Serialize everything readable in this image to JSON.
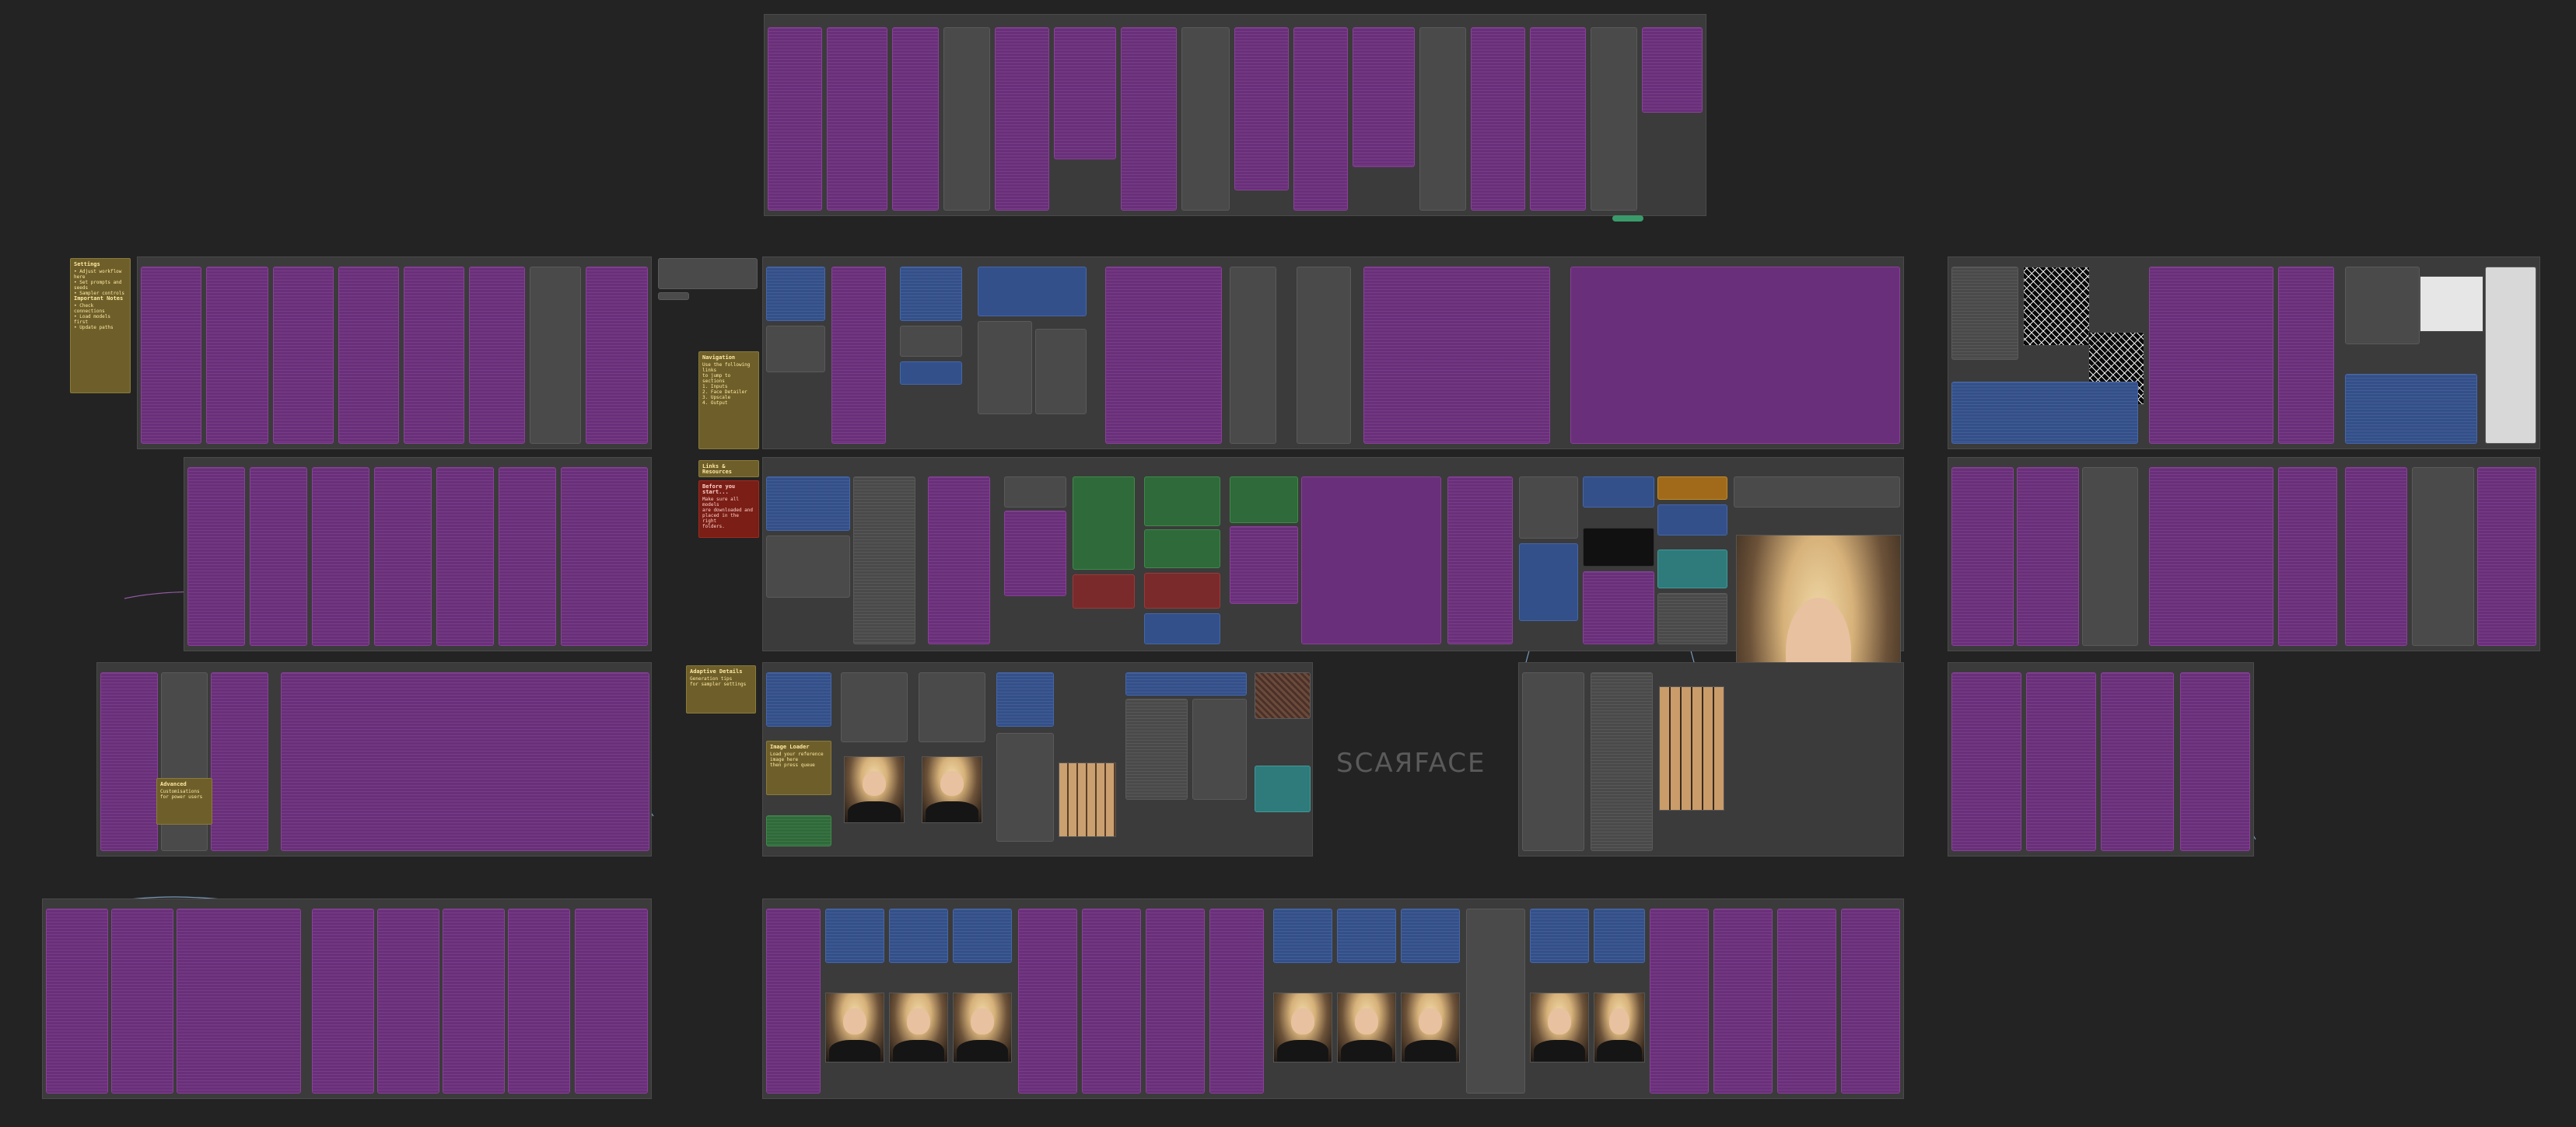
{
  "canvas": {
    "background": "#232323",
    "watermark": "SCAЯFACE",
    "colors": {
      "purple_node": "#6a2f7a",
      "blue_node": "#34508a",
      "green_node": "#2f6a3a",
      "red_node": "#7a2a2a",
      "teal_node": "#2f7a7a",
      "note_yellow": "#6e5f2a",
      "note_red": "#7a1e16",
      "wire_blue": "#8fb8e0",
      "wire_purple": "#c070d8"
    }
  },
  "notes": {
    "left_note": {
      "title": "Settings",
      "lines": [
        "• Adjust workflow here",
        "• Set prompts and seeds",
        "• Sampler controls",
        "Important Notes",
        "• Check connections",
        "• Load models first",
        "• Update paths"
      ]
    },
    "navigation": {
      "title": "Navigation",
      "lines": [
        "Use the following links",
        "to jump to sections",
        "1. Inputs",
        "2. Face Detailer",
        "3. Upscale",
        "4. Output"
      ]
    },
    "links": {
      "title": "Links & Resources"
    },
    "warning": {
      "title": "Before you start...",
      "lines": [
        "Make sure all models",
        "are downloaded and",
        "placed in the right",
        "folders."
      ]
    },
    "adaptive": {
      "title": "Adaptive Details",
      "lines": [
        "Generation tips",
        "for sampler settings"
      ]
    },
    "image_loader": {
      "title": "Image Loader",
      "lines": [
        "Load your reference",
        "image here",
        "then press queue"
      ]
    },
    "advanced": {
      "title": "Advanced",
      "lines": [
        "Customisations",
        "for power users"
      ]
    }
  }
}
